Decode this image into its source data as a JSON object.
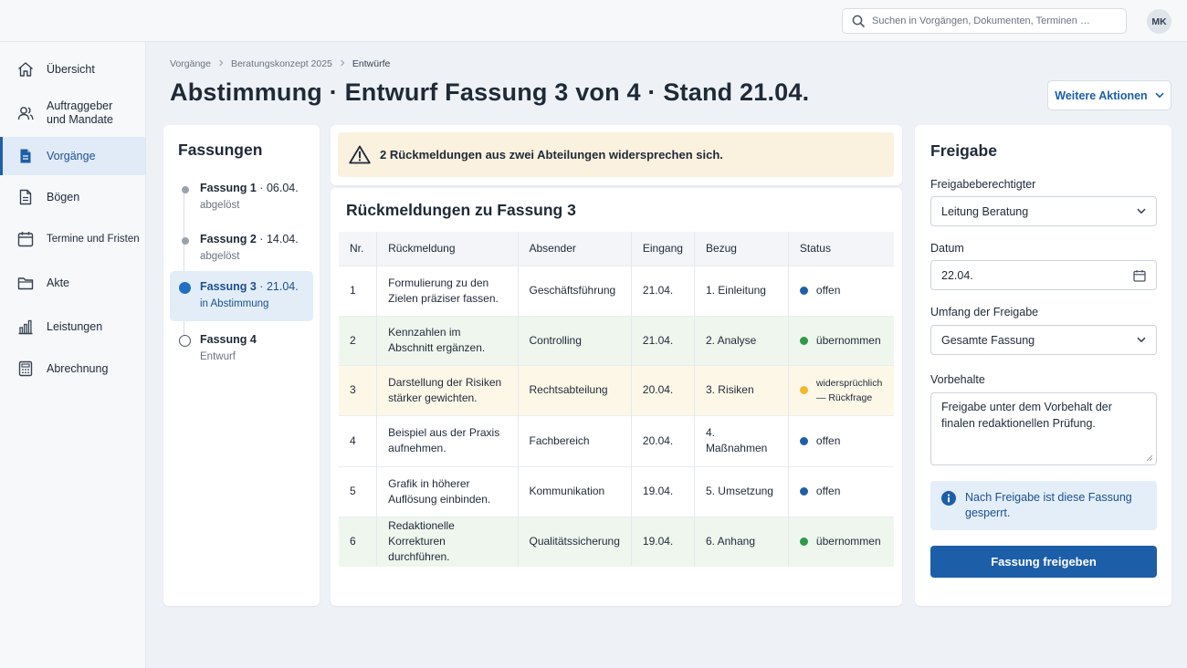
{
  "search": {
    "placeholder": "Suchen in Vorgängen, Dokumenten, Terminen …"
  },
  "user": {
    "initials": "MK"
  },
  "sidebar": {
    "items": [
      {
        "label": "Übersicht",
        "icon": "home-icon"
      },
      {
        "label": "Auftraggeber und Mandate",
        "icon": "users-icon"
      },
      {
        "label": "Vorgänge",
        "icon": "document-icon",
        "active": true
      },
      {
        "label": "Bögen",
        "icon": "file-icon"
      },
      {
        "label": "Termine und Fristen",
        "icon": "calendar-icon"
      },
      {
        "label": "Akte",
        "icon": "folder-icon"
      },
      {
        "label": "Leistungen",
        "icon": "bar-chart-icon"
      },
      {
        "label": "Abrechnung",
        "icon": "calculator-icon"
      }
    ]
  },
  "breadcrumb": [
    "Vorgänge",
    "Beratungskonzept 2025",
    "Entwürfe"
  ],
  "page": {
    "title": "Abstimmung · Entwurf Fassung 3 von 4 · Stand 21.04.",
    "more_actions": "Weitere Aktionen"
  },
  "versions": {
    "title": "Fassungen",
    "items": [
      {
        "name": "Fassung 1",
        "date": "06.04.",
        "status": "abgelöst"
      },
      {
        "name": "Fassung 2",
        "date": "14.04.",
        "status": "abgelöst"
      },
      {
        "name": "Fassung 3",
        "date": "21.04.",
        "status": "in Abstimmung",
        "active": true
      },
      {
        "name": "Fassung 4",
        "date": "",
        "status": "Entwurf"
      }
    ]
  },
  "warning": {
    "text": "2 Rückmeldungen aus zwei Abteilungen widersprechen sich.",
    "icon": "warning-icon"
  },
  "feedback": {
    "title": "Rückmeldungen zu Fassung 3",
    "columns": [
      "Nr.",
      "Rückmeldung",
      "Absender",
      "Eingang",
      "Bezug",
      "Status"
    ],
    "rows": [
      {
        "nr": "1",
        "text": "Formulierung zu den Zielen präziser fassen.",
        "sender": "Geschäftsführung",
        "date": "21.04.",
        "ref": "1. Einleitung",
        "status": "offen",
        "status_color": "#1f5fa8"
      },
      {
        "nr": "2",
        "text": "Kennzahlen im Abschnitt ergänzen.",
        "sender": "Controlling",
        "date": "21.04.",
        "ref": "2. Analyse",
        "status": "übernommen",
        "status_color": "#2e9a4a"
      },
      {
        "nr": "3",
        "text": "Darstellung der Risiken stärker gewichten.",
        "sender": "Rechtsabteilung",
        "date": "20.04.",
        "ref": "3. Risiken",
        "status": "widersprüchlich — Rückfrage",
        "status_color": "#f2b830"
      },
      {
        "nr": "4",
        "text": "Beispiel aus der Praxis aufnehmen.",
        "sender": "Fachbereich",
        "date": "20.04.",
        "ref": "4. Maßnahmen",
        "status": "offen",
        "status_color": "#1f5fa8"
      },
      {
        "nr": "5",
        "text": "Grafik in höherer Auflösung einbinden.",
        "sender": "Kommunikation",
        "date": "19.04.",
        "ref": "5. Umsetzung",
        "status": "offen",
        "status_color": "#1f5fa8"
      },
      {
        "nr": "6",
        "text": "Redaktionelle Korrekturen durchführen.",
        "sender": "Qualitätssicherung",
        "date": "19.04.",
        "ref": "6. Anhang",
        "status": "übernommen",
        "status_color": "#2e9a4a"
      }
    ]
  },
  "release": {
    "title": "Freigabe",
    "approver_label": "Freigabeberechtigter",
    "approver_value": "Leitung Beratung",
    "date_label": "Datum",
    "date_value": "22.04.",
    "scope_label": "Umfang der Freigabe",
    "scope_value": "Gesamte Fassung",
    "reservations_label": "Vorbehalte",
    "reservations_value": "Freigabe unter dem Vorbehalt der finalen redaktionellen Prüfung.",
    "info_text": "Nach Freigabe ist diese Fassung gesperrt.",
    "button": "Fassung freigeben"
  },
  "colors": {
    "accent": "#1d5ea8",
    "warning_bg": "#fbf1df",
    "success_row": "#eef6ee",
    "warning_row": "#fdf7e8"
  }
}
